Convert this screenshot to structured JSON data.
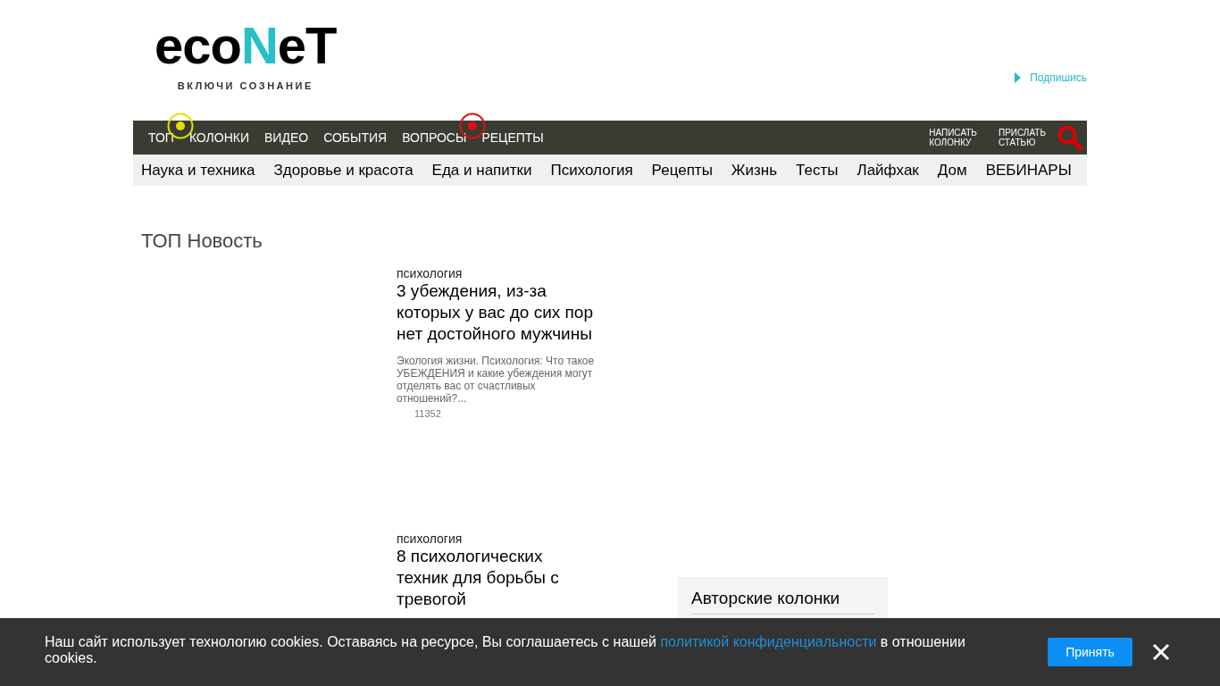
{
  "logo": {
    "parts": [
      {
        "text": "eco",
        "color": "#000000"
      },
      {
        "text": "N",
        "color": "#26c0c7"
      },
      {
        "text": "eT",
        "color": "#000000"
      }
    ],
    "tagline": "ВКЛЮЧИ СОЗНАНИЕ"
  },
  "subscribe": "Подпишись",
  "nav": {
    "items": [
      {
        "label": "ТОП",
        "marker": {
          "color": "#e5dd00"
        }
      },
      {
        "label": "КОЛОНКИ"
      },
      {
        "label": "ВИДЕО"
      },
      {
        "label": "СОБЫТИЯ"
      },
      {
        "label": "ВОПРОСЫ",
        "marker": {
          "color": "#e01010"
        }
      },
      {
        "label": "РЕЦЕПТЫ"
      }
    ],
    "actions": [
      [
        "НАПИСАТЬ",
        "КОЛОНКУ"
      ],
      [
        "ПРИСЛАТЬ",
        "СТАТЬЮ"
      ]
    ]
  },
  "categories": [
    "Наука и техника",
    "Здоровье и красота",
    "Еда и напитки",
    "Психология",
    "Рецепты",
    "Жизнь",
    "Тесты",
    "Лайфхак",
    "Дом",
    "ВЕБИНАРЫ"
  ],
  "section_title": "ТОП Новость",
  "articles": [
    {
      "category": "психология",
      "title": "3 убеждения, из-за которых у вас до сих пор нет достойного мужчины",
      "excerpt": "Экология жизни. Психология: Что такое УБЕЖДЕНИЯ и какие убеждения могут отделять вас от счастливых отношений?...",
      "views": "11352"
    },
    {
      "category": "психология",
      "title": "8 психологических техник для борьбы с тревогой"
    }
  ],
  "sidebar": {
    "title": "Авторские колонки"
  },
  "cookie": {
    "before": "Наш сайт использует технологию cookies. Оставаясь на ресурсе, Вы соглашаетесь с нашей ",
    "link": "политикой конфиденциальности",
    "after": " в отношении cookies.",
    "accept": "Принять"
  }
}
